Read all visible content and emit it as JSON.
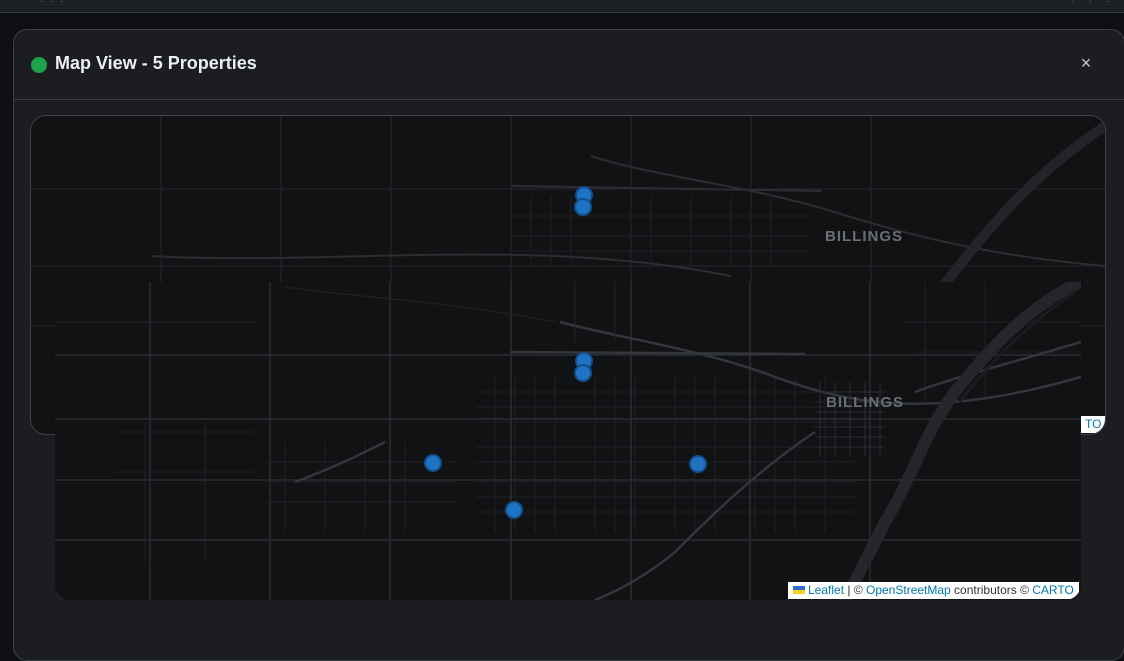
{
  "browser": {
    "left_text": "· · ·",
    "right_text": "· · ·"
  },
  "modal": {
    "title": "Map View - 5 Properties",
    "status_color": "#1fa34a",
    "close_label": "×"
  },
  "map": {
    "city_label": "BILLINGS",
    "marker_count": 5,
    "marker_color": "#1f73c4",
    "attribution": {
      "leaflet": "Leaflet",
      "separator": " | © ",
      "osm": "OpenStreetMap",
      "contributors": " contributors © ",
      "carto": "CARTO"
    },
    "back_attribution_fragment": "TO"
  }
}
